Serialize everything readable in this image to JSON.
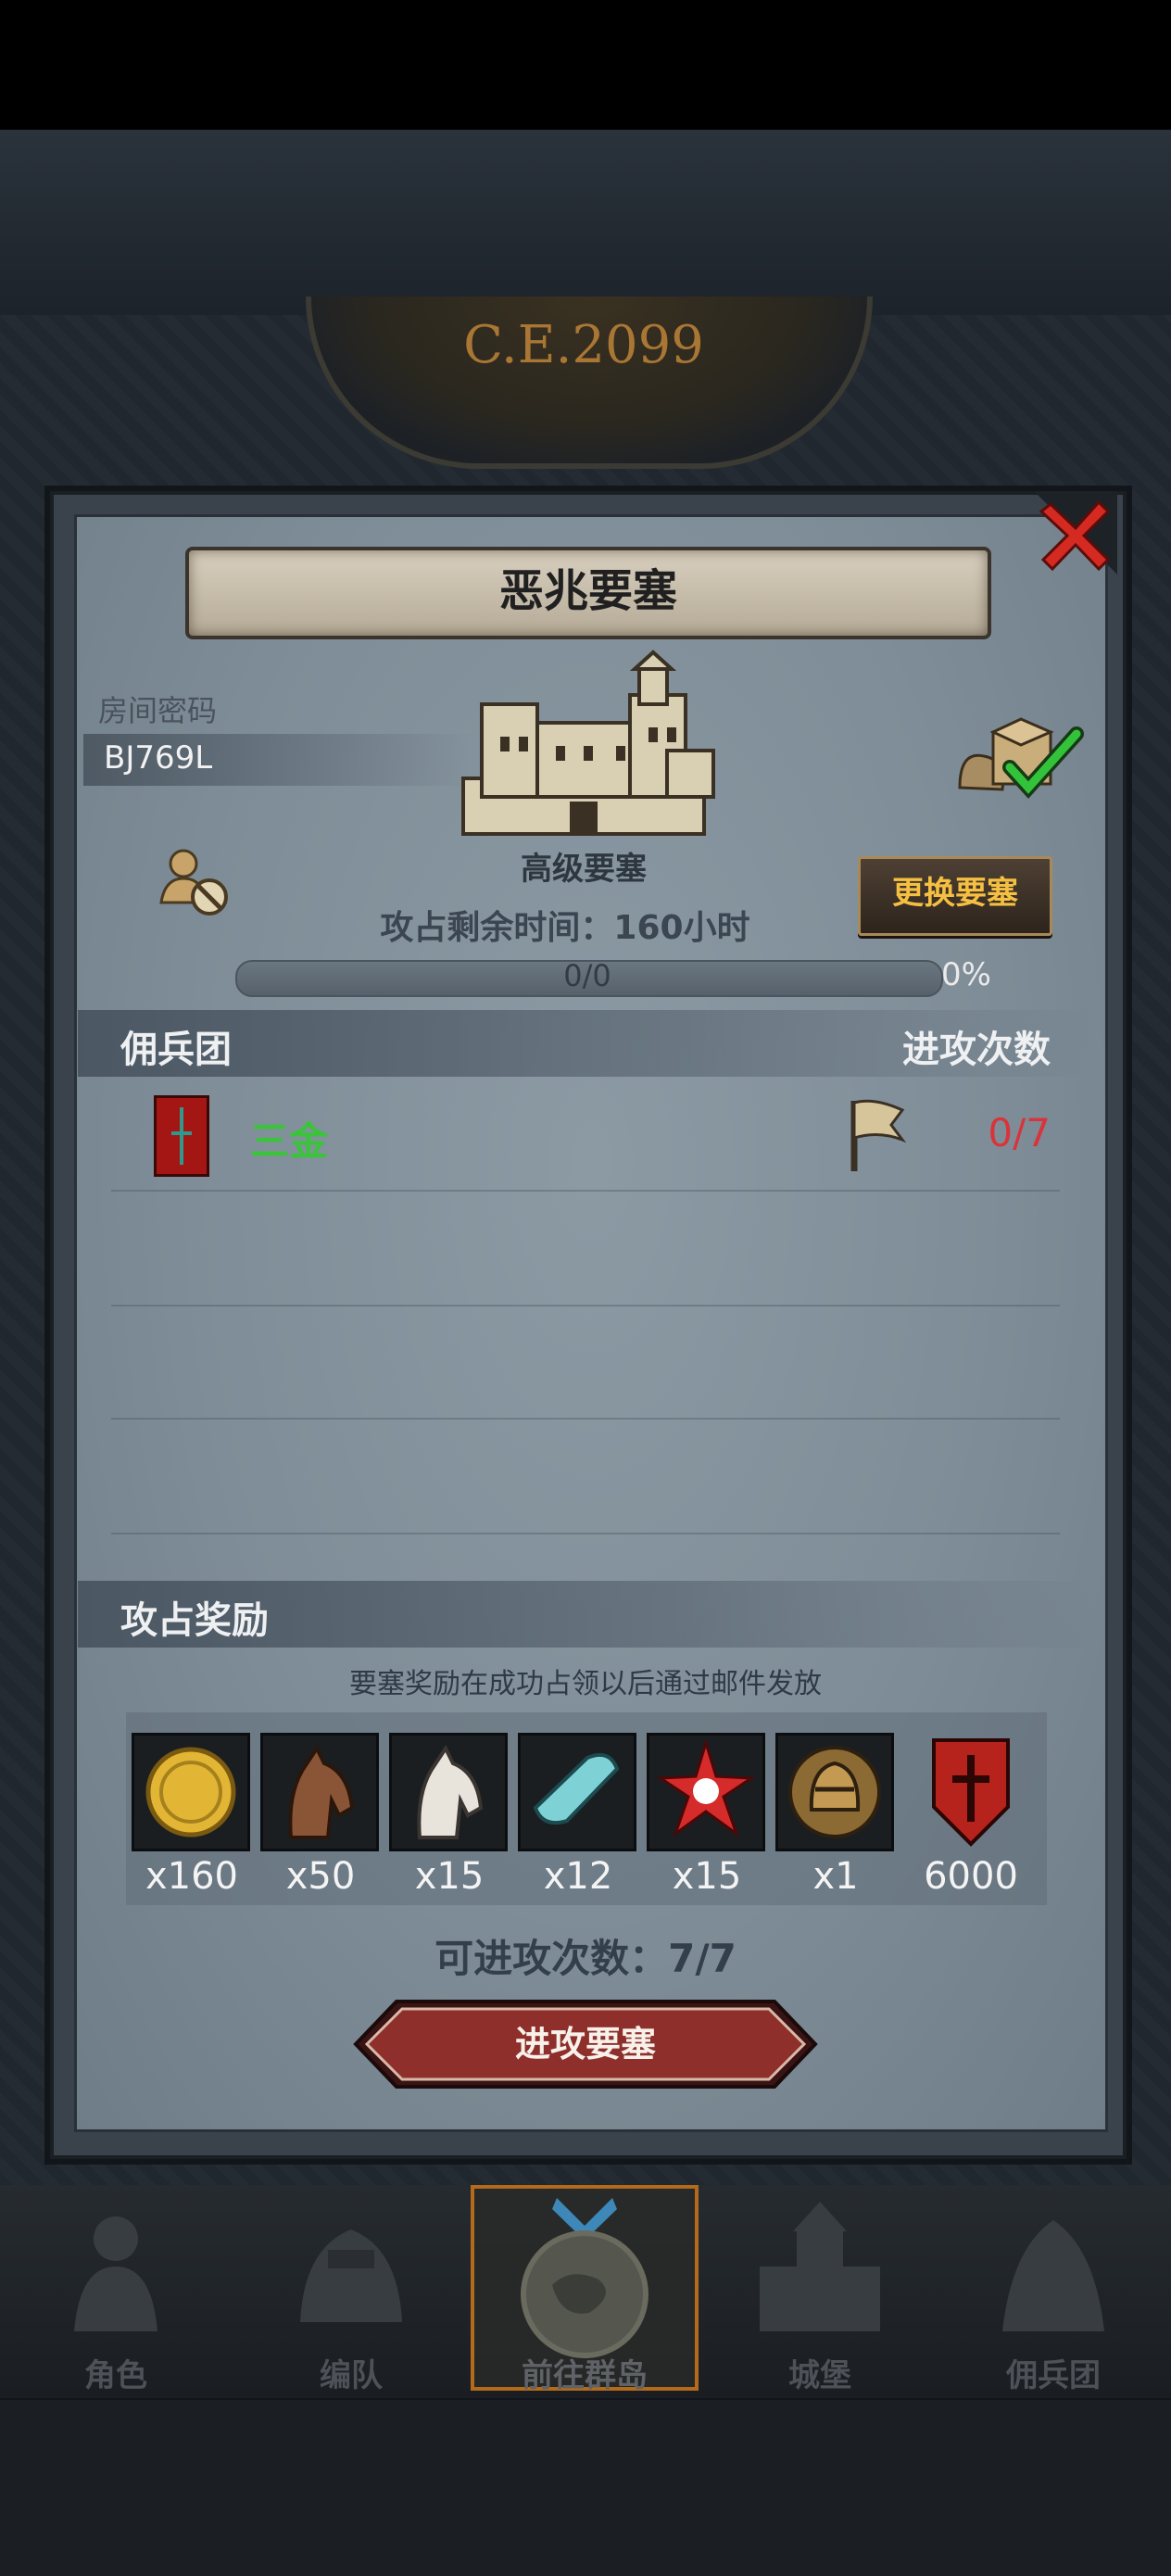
{
  "background": {
    "year_text": "C.E.2099"
  },
  "dialog": {
    "title": "恶兆要塞",
    "room_code_label": "房间密码",
    "room_code": "BJ769L",
    "fortress_level": "高级要塞",
    "change_button": "更换要塞",
    "time_left": "攻占剩余时间：160小时",
    "progress_text": "0/0",
    "progress_percent": "0%",
    "progress_value": 0,
    "mercenary_header": "佣兵团",
    "attack_count_header": "进攻次数",
    "mercenaries": [
      {
        "name": "三金",
        "attacks": "0/7"
      }
    ],
    "reward_header": "攻占奖励",
    "reward_note": "要塞奖励在成功占领以后通过邮件发放",
    "rewards": [
      {
        "icon": "gold-coin-icon",
        "qty": "x160"
      },
      {
        "icon": "brown-horse-icon",
        "qty": "x50"
      },
      {
        "icon": "white-horse-icon",
        "qty": "x15"
      },
      {
        "icon": "cloth-roll-icon",
        "qty": "x12"
      },
      {
        "icon": "red-crystal-icon",
        "qty": "x15"
      },
      {
        "icon": "knight-helmet-icon",
        "qty": "x1"
      },
      {
        "icon": "guild-banner-icon",
        "qty": "6000"
      }
    ],
    "attacks_available": "可进攻次数：7/7",
    "attack_button": "进攻要塞"
  },
  "nav": [
    {
      "label": "角色",
      "icon": "character-icon"
    },
    {
      "label": "编队",
      "icon": "formation-icon"
    },
    {
      "label": "前往群岛",
      "icon": "islands-icon",
      "active": true
    },
    {
      "label": "城堡",
      "icon": "castle-icon"
    },
    {
      "label": "佣兵团",
      "icon": "mercenary-icon"
    }
  ],
  "colors": {
    "accent_gold": "#f5c042",
    "name_green": "#3ac43a",
    "count_red": "#d9343a",
    "nav_active": "#b36a1a"
  }
}
